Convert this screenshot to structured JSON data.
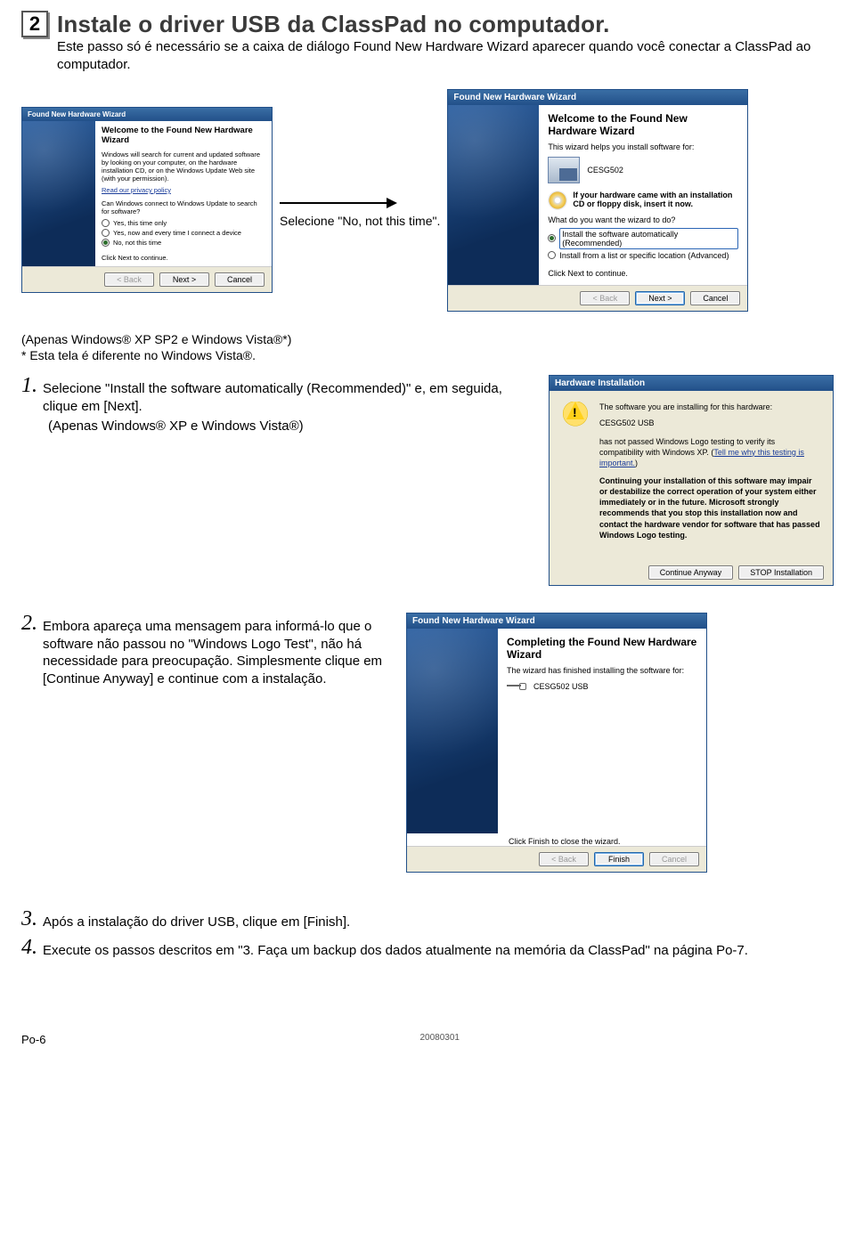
{
  "heading": {
    "step_badge": "2",
    "title": "Instale o driver USB da ClassPad no computador."
  },
  "intro": "Este passo só é necessário se a caixa de diálogo Found New Hardware Wizard aparecer quando você conectar a ClassPad ao computador.",
  "arrow_note": "Selecione \"No, not this time\".",
  "notes": {
    "line1": "(Apenas Windows® XP SP2 e Windows Vista®*)",
    "line2": "* Esta tela é diferente no Windows Vista®."
  },
  "step1": {
    "num": "1.",
    "text": "Selecione \"Install the software automatically (Recommended)\" e, em seguida, clique em [Next].",
    "sub": "(Apenas Windows® XP e Windows Vista®)"
  },
  "step2": {
    "num": "2.",
    "text": "Embora apareça uma mensagem para informá-lo que o software não passou no \"Windows Logo Test\", não há necessidade para preocupação. Simplesmente clique em [Continue Anyway] e continue com a instalação."
  },
  "step3": {
    "num": "3.",
    "text": "Após a instalação do driver USB, clique em [Finish]."
  },
  "step4": {
    "num": "4.",
    "text": "Execute os passos descritos em \"3. Faça um backup dos dados atualmente na memória da ClassPad\" na página Po-7."
  },
  "dialog_small": {
    "title": "Found New Hardware Wizard",
    "h": "Welcome to the Found New Hardware Wizard",
    "p1": "Windows will search for current and updated software by looking on your computer, on the hardware installation CD, or on the Windows Update Web site (with your permission).",
    "policy": "Read our privacy policy",
    "q": "Can Windows connect to Windows Update to search for software?",
    "opt1": "Yes, this time only",
    "opt2": "Yes, now and every time I connect a device",
    "opt3": "No, not this time",
    "cont": "Click Next to continue.",
    "back": "< Back",
    "next": "Next >",
    "cancel": "Cancel"
  },
  "dialog_big": {
    "title": "Found New Hardware Wizard",
    "h": "Welcome to the Found New Hardware Wizard",
    "p1": "This wizard helps you install software for:",
    "dev": "CESG502",
    "cd": "If your hardware came with an installation CD or floppy disk, insert it now.",
    "q": "What do you want the wizard to do?",
    "opt1": "Install the software automatically (Recommended)",
    "opt2": "Install from a list or specific location (Advanced)",
    "cont": "Click Next to continue.",
    "back": "< Back",
    "next": "Next >",
    "cancel": "Cancel"
  },
  "dialog_hwi": {
    "title": "Hardware Installation",
    "p1": "The software you are installing for this hardware:",
    "dev": "CESG502 USB",
    "p2a": "has not passed Windows Logo testing to verify its compatibility with Windows XP. (",
    "link": "Tell me why this testing is important.",
    "p2b": ")",
    "p3": "Continuing your installation of this software may impair or destabilize the correct operation of your system either immediately or in the future. Microsoft strongly recommends that you stop this installation now and contact the hardware vendor for software that has passed Windows Logo testing.",
    "btn1": "Continue Anyway",
    "btn2": "STOP Installation"
  },
  "dialog_finish": {
    "title": "Found New Hardware Wizard",
    "h": "Completing the Found New Hardware Wizard",
    "p1": "The wizard has finished installing the software for:",
    "dev": "CESG502 USB",
    "cont": "Click Finish to close the wizard.",
    "back": "< Back",
    "finish": "Finish",
    "cancel": "Cancel"
  },
  "footer": {
    "left": "Po-6",
    "mid": "20080301"
  }
}
